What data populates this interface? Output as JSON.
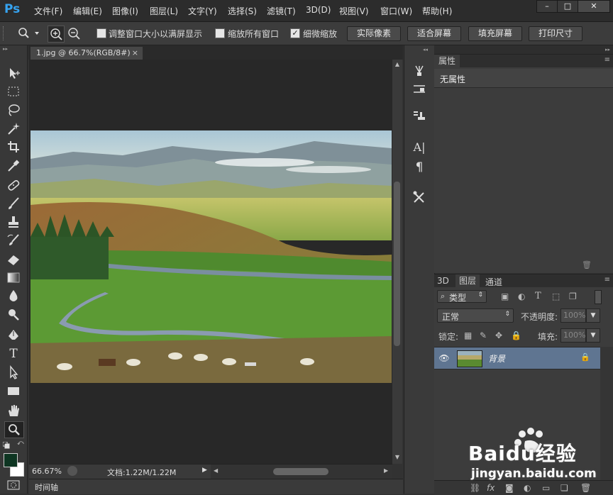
{
  "app": {
    "logo": "Ps"
  },
  "menu": [
    "文件(F)",
    "编辑(E)",
    "图像(I)",
    "图层(L)",
    "文字(Y)",
    "选择(S)",
    "滤镜(T)",
    "3D(D)",
    "视图(V)",
    "窗口(W)",
    "帮助(H)"
  ],
  "window_controls": {
    "minimize": "–",
    "maximize": "□",
    "close": "✕"
  },
  "options": {
    "resize_window_label": "调整窗口大小以满屏显示",
    "resize_window_checked": false,
    "zoom_all_label": "缩放所有窗口",
    "zoom_all_checked": false,
    "scrubby_zoom_label": "细微缩放",
    "scrubby_zoom_checked": true,
    "actual_pixels": "实际像素",
    "fit_screen": "适合屏幕",
    "fill_screen": "填充屏幕",
    "print_size": "打印尺寸"
  },
  "document": {
    "tab_title": "1.jpg @ 66.7%(RGB/8#)",
    "close": "×",
    "zoom_level": "66.67%",
    "doc_size": "文档:1.22M/1.22M"
  },
  "timeline": {
    "label": "时间轴"
  },
  "properties": {
    "tab": "属性",
    "empty": "无属性"
  },
  "layers": {
    "tabs": [
      "3D",
      "图层",
      "通道"
    ],
    "filter_kind": "类型",
    "blend_mode": "正常",
    "opacity_label": "不透明度:",
    "opacity_value": "100%",
    "lock_label": "锁定:",
    "fill_label": "填充:",
    "fill_value": "100%",
    "items": [
      {
        "name": "背景",
        "visible": true,
        "locked": true
      }
    ]
  },
  "watermark": {
    "brand": "Baidu经验",
    "url": "jingyan.baidu.com"
  },
  "colors": {
    "ps_blue": "#36a3f0",
    "selected_layer": "#5f7591",
    "foreground": "#0e3522",
    "background": "#ffffff"
  }
}
